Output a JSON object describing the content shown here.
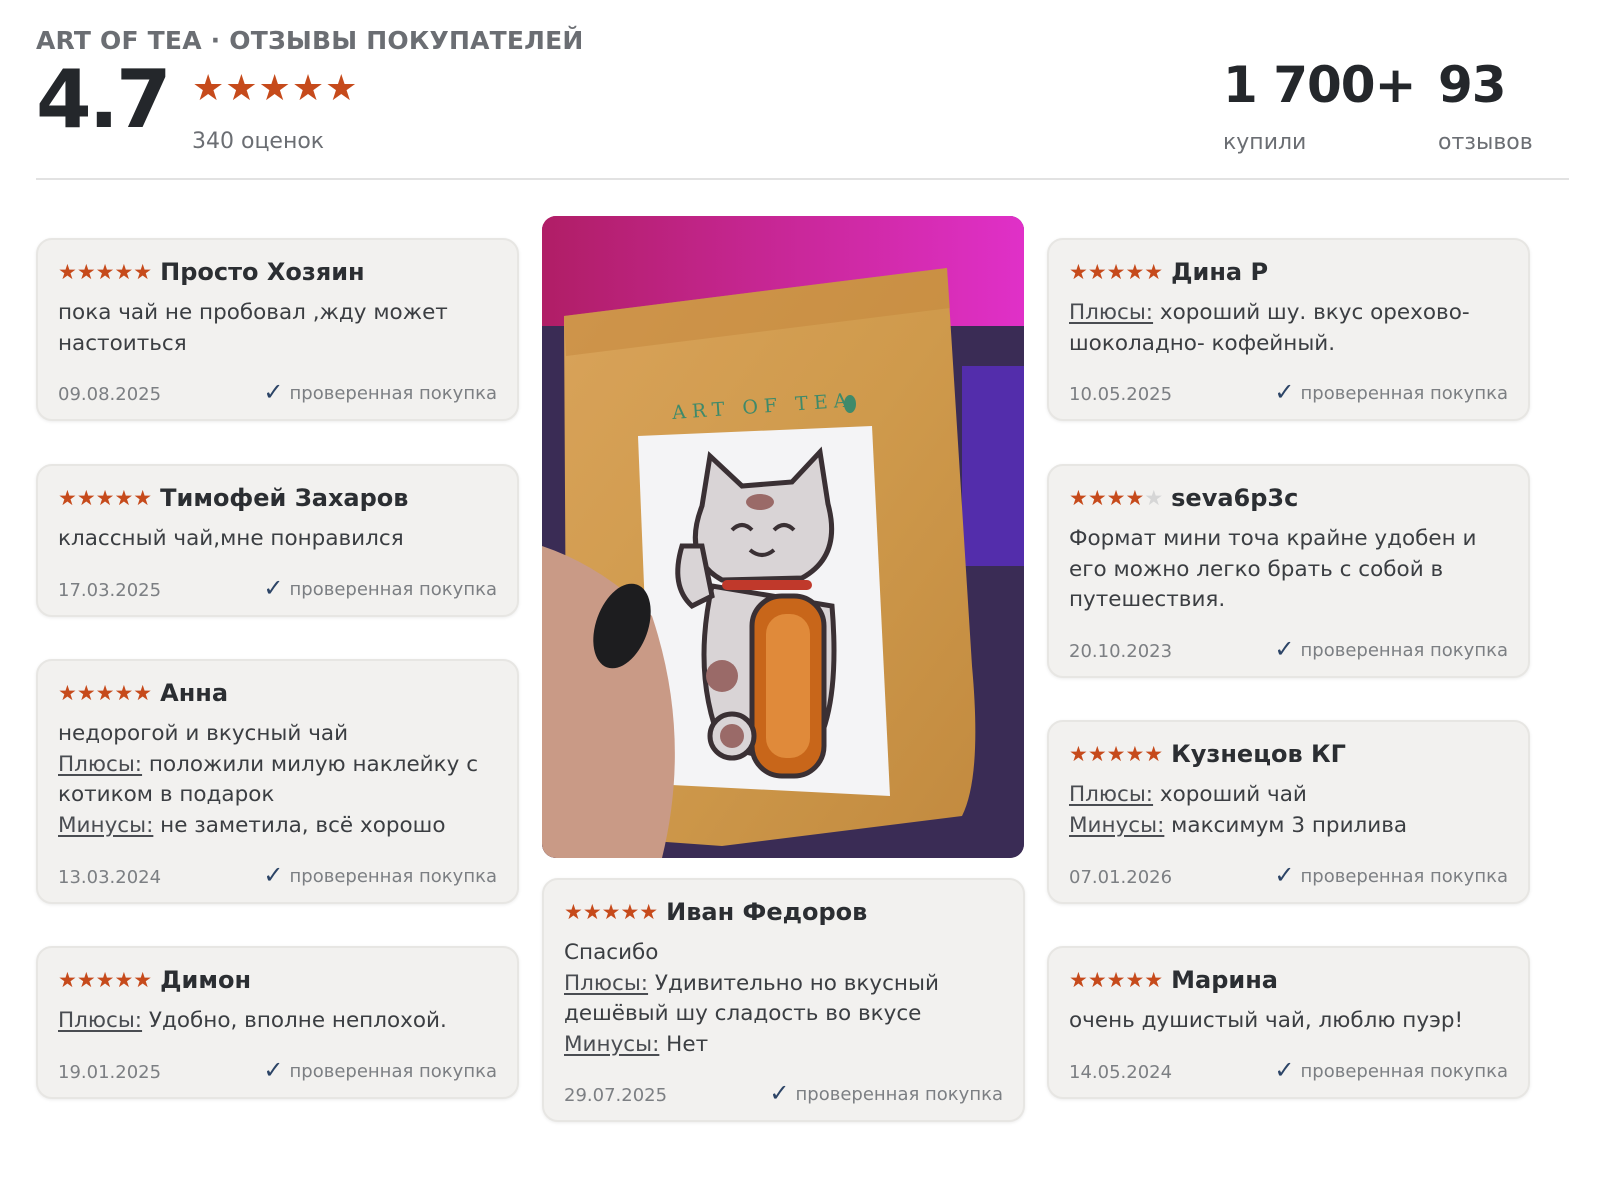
{
  "header": {
    "brand": "ART OF TEA · ОТЗЫВЫ ПОКУПАТЕЛЕЙ",
    "rating": "4.7",
    "stars": "★★★★★",
    "ratings_count": "340 оценок",
    "stats": [
      {
        "value": "1 700+",
        "label": "купили"
      },
      {
        "value": "93",
        "label": "отзывов"
      }
    ]
  },
  "verified_label": "проверенная покупка",
  "colors": {
    "accent_star": "#c64a1b",
    "card_bg": "#f2f1ef",
    "check": "#2c4466"
  },
  "photo": {
    "package_text": "ART OF TEA",
    "alt": "пакет чая с наклейкой котика"
  },
  "reviews": [
    {
      "stars": "★★★★★",
      "empty": "",
      "author": "Просто Хозяин",
      "text": "пока чай не пробовал ,жду может настоиться",
      "plus_label": "",
      "plus": "",
      "minus_label": "",
      "minus": "",
      "date": "09.08.2025"
    },
    {
      "stars": "★★★★★",
      "empty": "",
      "author": "Тимофей Захаров",
      "text": "классный чай,мне понравился",
      "plus_label": "",
      "plus": "",
      "minus_label": "",
      "minus": "",
      "date": "17.03.2025"
    },
    {
      "stars": "★★★★★",
      "empty": "",
      "author": "Анна",
      "text": "недорогой и вкусный чай",
      "plus_label": "Плюсы:",
      "plus": " положили милую наклейку с котиком в подарок",
      "minus_label": "Минусы:",
      "minus": " не заметила, всё хорошо",
      "date": "13.03.2024"
    },
    {
      "stars": "★★★★★",
      "empty": "",
      "author": "Димон",
      "text": "",
      "plus_label": "Плюсы:",
      "plus": " Удобно, вполне неплохой.",
      "minus_label": "",
      "minus": "",
      "date": "19.01.2025"
    },
    {
      "stars": "★★★★★",
      "empty": "",
      "author": "Иван Федоров",
      "text": "Спасибо",
      "plus_label": "Плюсы:",
      "plus": " Удивительно но вкусный дешёвый шу сладость во вкусе",
      "minus_label": "Минусы:",
      "minus": " Нет",
      "date": "29.07.2025"
    },
    {
      "stars": "★★★★★",
      "empty": "",
      "author": "Дина Р",
      "text": "",
      "plus_label": "Плюсы:",
      "plus": " хороший шу. вкус орехово-шоколадно- кофейный.",
      "minus_label": "",
      "minus": "",
      "date": "10.05.2025"
    },
    {
      "stars": "★★★★",
      "empty": "★",
      "author": "seva6p3c",
      "text": "Формат мини точа крайне удобен и его можно легко брать с собой в путешествия.",
      "plus_label": "",
      "plus": "",
      "minus_label": "",
      "minus": "",
      "date": "20.10.2023"
    },
    {
      "stars": "★★★★★",
      "empty": "",
      "author": "Кузнецов КГ",
      "text": "",
      "plus_label": "Плюсы:",
      "plus": " хороший чай",
      "minus_label": "Минусы:",
      "minus": " максимум 3 прилива",
      "date": "07.01.2026"
    },
    {
      "stars": "★★★★★",
      "empty": "",
      "author": "Марина",
      "text": "очень душистый чай, люблю пуэр!",
      "plus_label": "",
      "plus": "",
      "minus_label": "",
      "minus": "",
      "date": "14.05.2024"
    }
  ]
}
